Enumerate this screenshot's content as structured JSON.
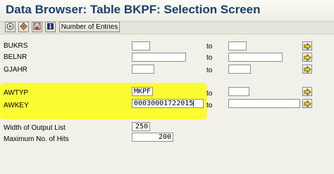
{
  "title": "Data Browser: Table BKPF: Selection Screen",
  "toolbar": {
    "execute_icon": "execute-icon",
    "variant_icon": "variant-icon",
    "save_icon": "save-variant-icon",
    "info_icon": "info-icon",
    "number_of_entries_label": "Number of Entries"
  },
  "to_label": "to",
  "fields": [
    {
      "label": "BUKRS",
      "from_value": "",
      "to_value": ""
    },
    {
      "label": "BELNR",
      "from_value": "",
      "to_value": ""
    },
    {
      "label": "GJAHR",
      "from_value": "",
      "to_value": ""
    },
    {
      "label": "AWTYP",
      "from_value": "MKPF",
      "to_value": ""
    },
    {
      "label": "AWKEY",
      "from_value": "00030001722015",
      "to_value": ""
    }
  ],
  "output": {
    "width_label": "Width of Output List",
    "width_value": "250",
    "max_hits_label": "Maximum No. of Hits",
    "max_hits_value": "200"
  },
  "colors": {
    "title": "#1a3f6d",
    "highlight": "#fbfb33",
    "background": "#f1f1ea"
  }
}
